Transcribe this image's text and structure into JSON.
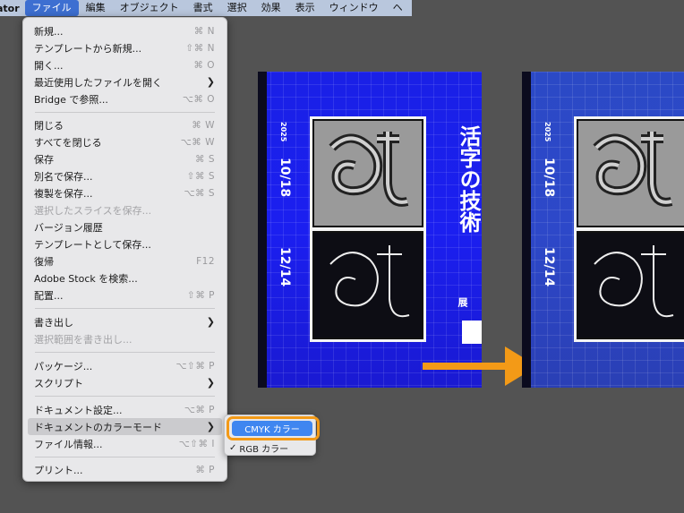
{
  "menubar": {
    "app_name": "ator",
    "items": [
      "ファイル",
      "編集",
      "オブジェクト",
      "書式",
      "選択",
      "効果",
      "表示",
      "ウィンドウ",
      "ヘ"
    ]
  },
  "file_menu": {
    "items": [
      {
        "label": "新規...",
        "shortcut": "⌘ N"
      },
      {
        "label": "テンプレートから新規...",
        "shortcut": "⇧⌘ N"
      },
      {
        "label": "開く...",
        "shortcut": "⌘ O"
      },
      {
        "label": "最近使用したファイルを開く",
        "submenu": true
      },
      {
        "label": "Bridge で参照...",
        "shortcut": "⌥⌘ O"
      },
      {
        "label": "閉じる",
        "shortcut": "⌘ W"
      },
      {
        "label": "すべてを閉じる",
        "shortcut": "⌥⌘ W"
      },
      {
        "label": "保存",
        "shortcut": "⌘ S"
      },
      {
        "label": "別名で保存...",
        "shortcut": "⇧⌘ S"
      },
      {
        "label": "複製を保存...",
        "shortcut": "⌥⌘ S"
      },
      {
        "label": "選択したスライスを保存...",
        "disabled": true
      },
      {
        "label": "バージョン履歴"
      },
      {
        "label": "テンプレートとして保存..."
      },
      {
        "label": "復帰",
        "shortcut": "F12"
      },
      {
        "label": "Adobe Stock を検索..."
      },
      {
        "label": "配置...",
        "shortcut": "⇧⌘ P"
      },
      {
        "label": "書き出し",
        "submenu": true
      },
      {
        "label": "選択範囲を書き出し...",
        "disabled": true
      },
      {
        "label": "パッケージ...",
        "shortcut": "⌥⇧⌘ P"
      },
      {
        "label": "スクリプト",
        "submenu": true
      },
      {
        "label": "ドキュメント設定...",
        "shortcut": "⌥⌘ P"
      },
      {
        "label": "ドキュメントのカラーモード",
        "submenu": true
      },
      {
        "label": "ファイル情報...",
        "shortcut": "⌥⇧⌘ I"
      },
      {
        "label": "プリント...",
        "shortcut": "⌘ P"
      }
    ]
  },
  "color_mode_submenu": {
    "cmyk_label": "CMYK カラー",
    "rgb_label": "RGB カラー",
    "rgb_check": "✓"
  },
  "poster": {
    "title": "活字の技術",
    "title_suffix": "展",
    "year": "2025",
    "start_date": "10/18",
    "end_date": "12/14"
  },
  "colors": {
    "rgb_blue": "#1b1ff0",
    "cmyk_blue": "#2d48c9",
    "accent_orange": "#f39a17",
    "selection_blue": "#3f86f0"
  }
}
